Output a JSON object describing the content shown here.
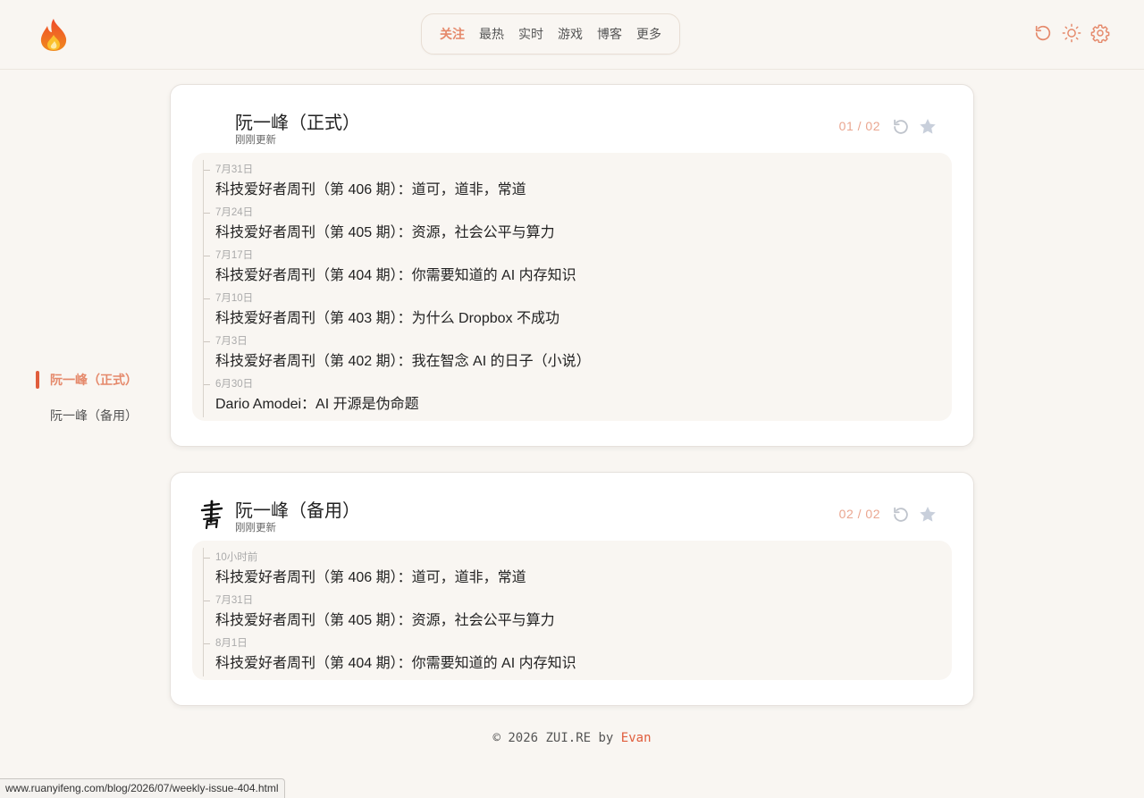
{
  "nav": {
    "tabs": [
      {
        "label": "关注"
      },
      {
        "label": "最热"
      },
      {
        "label": "实时"
      },
      {
        "label": "游戏"
      },
      {
        "label": "博客"
      },
      {
        "label": "更多"
      }
    ],
    "active_tab": "关注"
  },
  "header_icons": [
    "history-icon",
    "sun-icon",
    "gear-icon"
  ],
  "sidebar": {
    "items": [
      {
        "label": "阮一峰（正式）",
        "active": true
      },
      {
        "label": "阮一峰（备用）",
        "active": false
      }
    ]
  },
  "cards": [
    {
      "title": "阮一峰（正式）",
      "subtitle": "刚刚更新",
      "page": "01 / 02",
      "items": [
        {
          "date": "7月31日",
          "title": "科技爱好者周刊（第 406 期）：道可，道非，常道"
        },
        {
          "date": "7月24日",
          "title": "科技爱好者周刊（第 405 期）：资源，社会公平与算力"
        },
        {
          "date": "7月17日",
          "title": "科技爱好者周刊（第 404 期）：你需要知道的 AI 内存知识"
        },
        {
          "date": "7月10日",
          "title": "科技爱好者周刊（第 403 期）：为什么 Dropbox 不成功"
        },
        {
          "date": "7月3日",
          "title": "科技爱好者周刊（第 402 期）：我在智念 AI 的日子（小说）"
        },
        {
          "date": "6月30日",
          "title": "Dario Amodei：AI 开源是伪命题"
        }
      ]
    },
    {
      "title": "阮一峰（备用）",
      "subtitle": "刚刚更新",
      "page": "02 / 02",
      "avatar_glyph": "書",
      "items": [
        {
          "date": "10小时前",
          "title": "科技爱好者周刊（第 406 期）：道可，道非，常道"
        },
        {
          "date": "7月31日",
          "title": "科技爱好者周刊（第 405 期）：资源，社会公平与算力"
        },
        {
          "date": "8月1日",
          "title": "科技爱好者周刊（第 404 期）：你需要知道的 AI 内存知识"
        }
      ]
    }
  ],
  "footer": {
    "prefix": "© 2026 ZUI.RE by ",
    "author": "Evan"
  },
  "status_url": "www.ruanyifeng.com/blog/2026/07/weekly-issue-404.html",
  "colors": {
    "accent": "#e5896b",
    "accent_strong": "#e05d3c",
    "background": "#f9f6f2",
    "star": "#c8cfdb"
  }
}
